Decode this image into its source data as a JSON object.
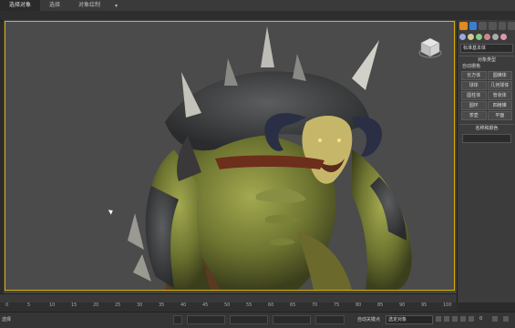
{
  "menubar": {
    "tabs": [
      "选择对象",
      "选择",
      "对象绘制"
    ],
    "dropdown": "▾"
  },
  "viewport": {
    "label": ""
  },
  "right_panel": {
    "dropdown_value": "标准基本体",
    "section_object_type": "对象类型",
    "autogrid": "自动栅格",
    "buttons": [
      "长方体",
      "圆锥体",
      "球体",
      "几何球体",
      "圆柱体",
      "管状体",
      "圆环",
      "四棱锥",
      "茶壶",
      "平面"
    ],
    "section_name_color": "名称和颜色"
  },
  "timeline": {
    "ticks": [
      "0",
      "5",
      "10",
      "15",
      "20",
      "25",
      "30",
      "35",
      "40",
      "45",
      "50",
      "55",
      "60",
      "65",
      "70",
      "75",
      "80",
      "85",
      "90",
      "95",
      "100"
    ]
  },
  "status": {
    "left_text": "选择",
    "selection_set": "选定对象",
    "frame_value": "0",
    "auto_key_label": "自动关键点"
  },
  "colors": {
    "viewport_border": "#d6b000",
    "accent": "#e08a22",
    "background": "#2b2b2b"
  }
}
